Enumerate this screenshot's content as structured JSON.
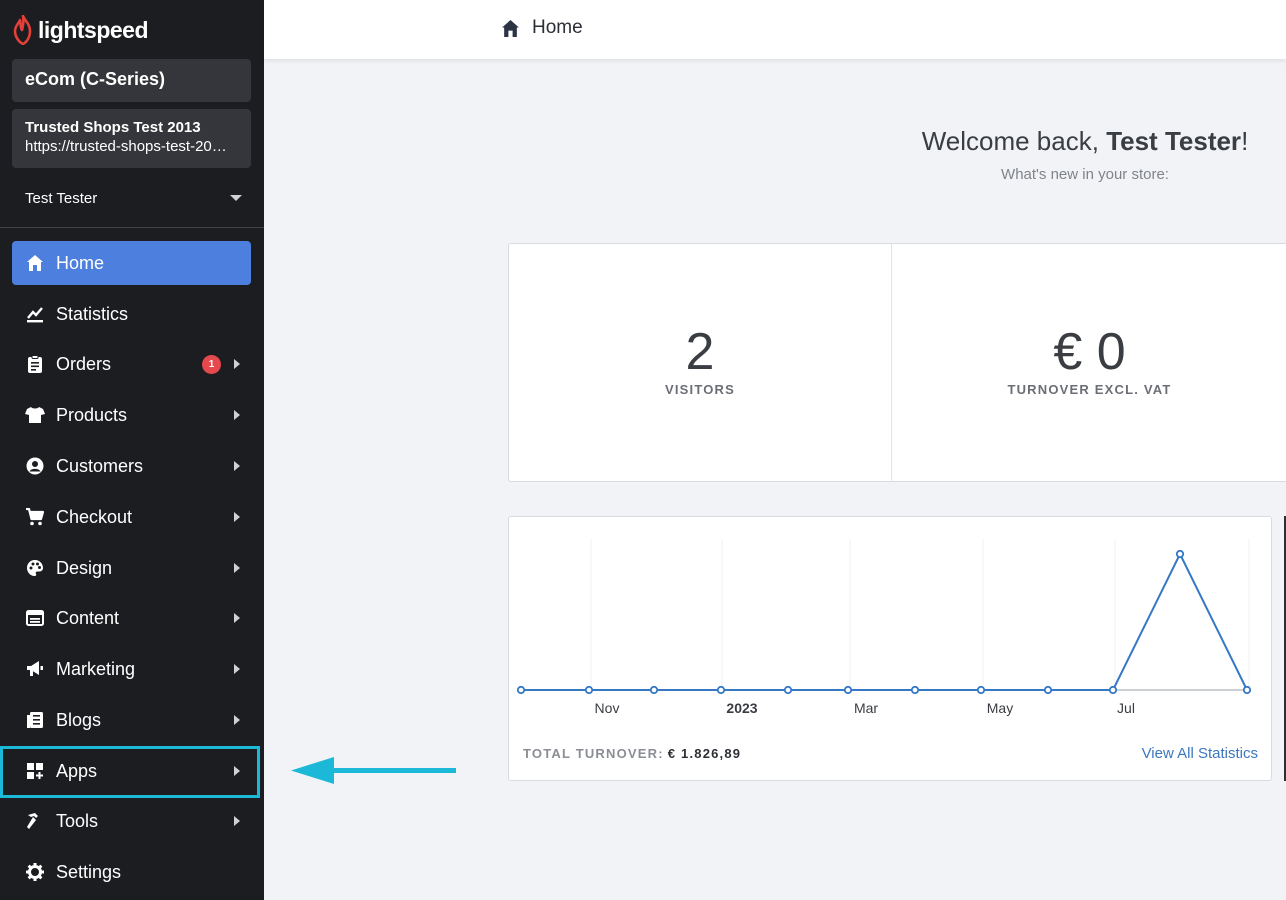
{
  "app": {
    "brand": "lightspeed"
  },
  "sidebar": {
    "product": "eCom (C-Series)",
    "shop_name": "Trusted Shops Test 2013",
    "shop_url": "https://trusted-shops-test-20…",
    "user": "Test Tester",
    "items": [
      {
        "label": "Home",
        "icon": "home-icon",
        "active": true
      },
      {
        "label": "Statistics",
        "icon": "statistics-icon"
      },
      {
        "label": "Orders",
        "icon": "clipboard-icon",
        "badge": "1"
      },
      {
        "label": "Products",
        "icon": "tshirt-icon"
      },
      {
        "label": "Customers",
        "icon": "user-circle-icon"
      },
      {
        "label": "Checkout",
        "icon": "cart-icon"
      },
      {
        "label": "Design",
        "icon": "palette-icon"
      },
      {
        "label": "Content",
        "icon": "content-icon"
      },
      {
        "label": "Marketing",
        "icon": "megaphone-icon"
      },
      {
        "label": "Blogs",
        "icon": "blog-icon"
      },
      {
        "label": "Apps",
        "icon": "apps-icon",
        "highlighted": true
      },
      {
        "label": "Tools",
        "icon": "hammer-icon"
      },
      {
        "label": "Settings",
        "icon": "gear-icon"
      }
    ]
  },
  "header": {
    "breadcrumb": "Home"
  },
  "main": {
    "welcome_prefix": "Welcome back, ",
    "welcome_name": "Test Tester",
    "welcome_suffix": "!",
    "subtitle": "What's new in your store:",
    "stats": [
      {
        "value": "2",
        "label": "VISITORS"
      },
      {
        "value": "€ 0",
        "label": "TURNOVER EXCL. VAT"
      }
    ],
    "total_label": "TOTAL TURNOVER:",
    "total_value": "€ 1.826,89",
    "view_all": "View All Statistics"
  },
  "colors": {
    "accent": "#4d7fde",
    "sidebar": "#1b1d21",
    "line": "#3478c6",
    "highlight": "#1cb8d8",
    "badge": "#e5484d"
  },
  "chart_data": {
    "type": "line",
    "x_ticks": [
      "Nov",
      "2023",
      "Mar",
      "May",
      "Jul"
    ],
    "values": [
      0,
      0,
      0,
      0,
      0,
      0,
      0,
      0,
      0,
      0,
      1826.89,
      0
    ],
    "grid": true
  }
}
